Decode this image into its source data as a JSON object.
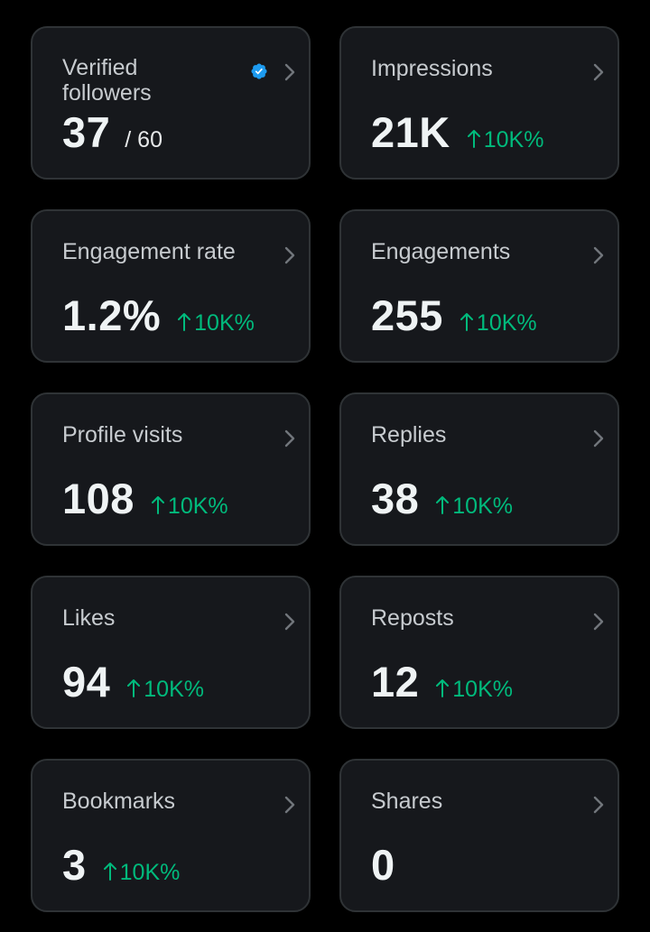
{
  "colors": {
    "background": "#000000",
    "card_background": "#16181c",
    "card_border": "#2f3336",
    "positive": "#00ba7c",
    "verified_badge": "#1d9bf0"
  },
  "cards": [
    {
      "title": "Verified followers",
      "value": "37",
      "sub": "/ 60",
      "change": "",
      "icon": "verified-badge-icon"
    },
    {
      "title": "Impressions",
      "value": "21K",
      "sub": "",
      "change": "10K%"
    },
    {
      "title": "Engagement rate",
      "value": "1.2%",
      "sub": "",
      "change": "10K%"
    },
    {
      "title": "Engagements",
      "value": "255",
      "sub": "",
      "change": "10K%"
    },
    {
      "title": "Profile visits",
      "value": "108",
      "sub": "",
      "change": "10K%"
    },
    {
      "title": "Replies",
      "value": "38",
      "sub": "",
      "change": "10K%"
    },
    {
      "title": "Likes",
      "value": "94",
      "sub": "",
      "change": "10K%"
    },
    {
      "title": "Reposts",
      "value": "12",
      "sub": "",
      "change": "10K%"
    },
    {
      "title": "Bookmarks",
      "value": "3",
      "sub": "",
      "change": "10K%"
    },
    {
      "title": "Shares",
      "value": "0",
      "sub": "",
      "change": ""
    }
  ]
}
